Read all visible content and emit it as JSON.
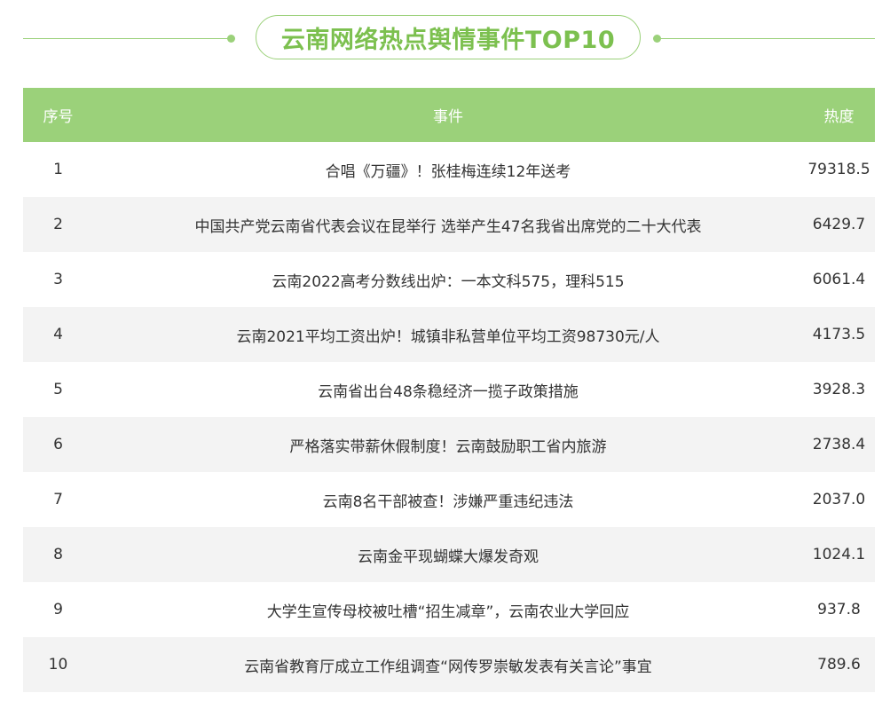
{
  "title": "云南网络热点舆情事件TOP10",
  "colors": {
    "accent": "#9bd17a",
    "title_text": "#7cc04f",
    "row_alt": "#f3f3f3"
  },
  "table": {
    "headers": {
      "rank": "序号",
      "event": "事件",
      "heat": "热度"
    },
    "rows": [
      {
        "rank": "1",
        "event": "合唱《万疆》！张桂梅连续12年送考",
        "heat": "79318.5"
      },
      {
        "rank": "2",
        "event": "中国共产党云南省代表会议在昆举行 选举产生47名我省出席党的二十大代表",
        "heat": "6429.7"
      },
      {
        "rank": "3",
        "event": "云南2022高考分数线出炉：一本文科575，理科515",
        "heat": "6061.4"
      },
      {
        "rank": "4",
        "event": "云南2021平均工资出炉！城镇非私营单位平均工资98730元/人",
        "heat": "4173.5"
      },
      {
        "rank": "5",
        "event": "云南省出台48条稳经济一揽子政策措施",
        "heat": "3928.3"
      },
      {
        "rank": "6",
        "event": "严格落实带薪休假制度！云南鼓励职工省内旅游",
        "heat": "2738.4"
      },
      {
        "rank": "7",
        "event": "云南8名干部被查！涉嫌严重违纪违法",
        "heat": "2037.0"
      },
      {
        "rank": "8",
        "event": "云南金平现蝴蝶大爆发奇观",
        "heat": "1024.1"
      },
      {
        "rank": "9",
        "event": "大学生宣传母校被吐槽“招生减章”，云南农业大学回应",
        "heat": "937.8"
      },
      {
        "rank": "10",
        "event": "云南省教育厅成立工作组调查“网传罗崇敏发表有关言论”事宜",
        "heat": "789.6"
      }
    ]
  }
}
